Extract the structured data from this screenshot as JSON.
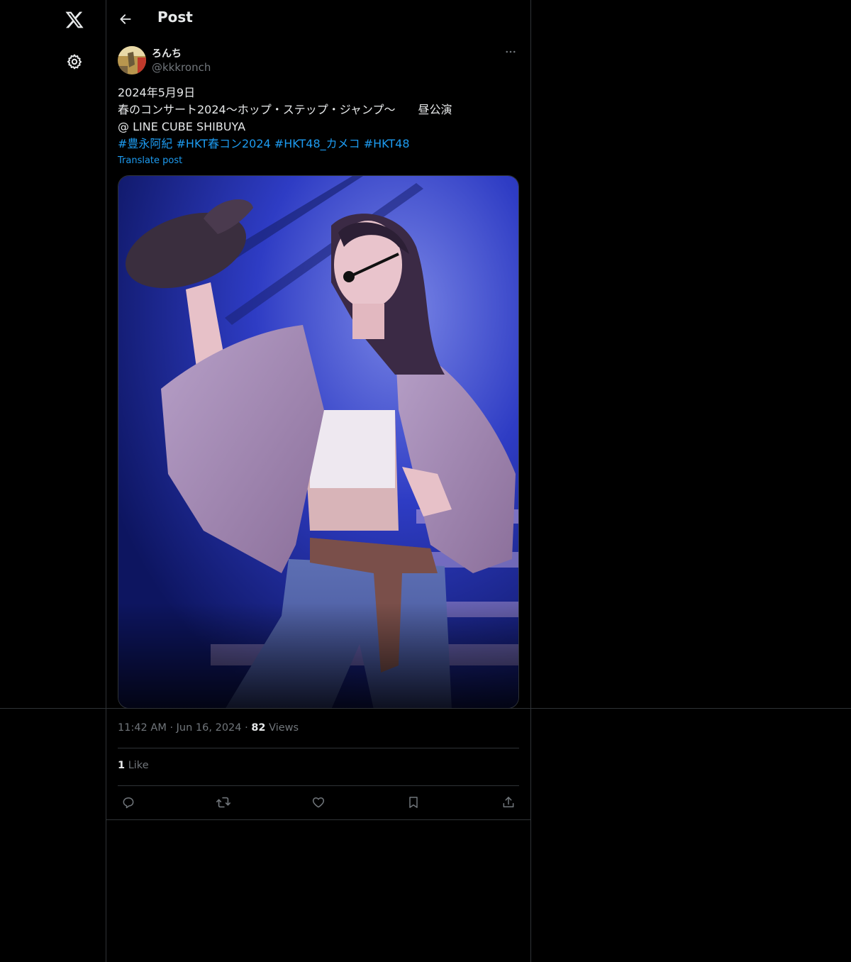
{
  "nav": {
    "logo_icon": "x-logo-icon",
    "settings_icon": "gear-icon"
  },
  "header": {
    "back_icon": "arrow-left-icon",
    "title": "Post"
  },
  "post": {
    "author": {
      "display_name": "ろんち",
      "handle": "@kkkronch"
    },
    "more_icon": "more-horizontal-icon",
    "text_lines": [
      "2024年5月9日",
      "春のコンサート2024〜ホップ・ステップ・ジャンプ〜　　昼公演",
      "@ LINE CUBE SHIBUYA"
    ],
    "hashtags": [
      "#豊永阿紀",
      "#HKT春コン2024",
      "#HKT48_カメコ",
      "#HKT48"
    ],
    "translate_label": "Translate post",
    "time": "11:42 AM",
    "date": "Jun 16, 2024",
    "dot": "·",
    "views_count": "82",
    "views_label": "Views",
    "likes_count": "1",
    "likes_label": "Like"
  },
  "actions": [
    {
      "name": "reply",
      "icon": "reply-icon"
    },
    {
      "name": "repost",
      "icon": "repost-icon"
    },
    {
      "name": "like",
      "icon": "heart-icon"
    },
    {
      "name": "bookmark",
      "icon": "bookmark-icon"
    },
    {
      "name": "share",
      "icon": "share-icon"
    }
  ],
  "colors": {
    "background": "#000000",
    "text": "#e7e9ea",
    "muted": "#71767b",
    "link": "#1d9bf0",
    "border": "#2f3336"
  }
}
